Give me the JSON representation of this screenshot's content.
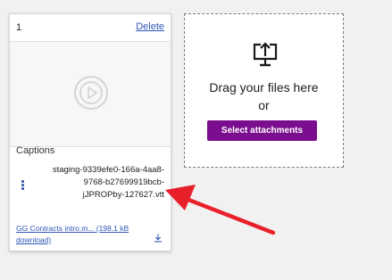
{
  "card": {
    "index": "1",
    "delete_label": "Delete",
    "captions_title": "Captions",
    "caption_file_lines": [
      "staging-9339efe0-166a-4aa8-",
      "9768-b27699919bcb-",
      "jJPROPby-127627.vtt"
    ],
    "download_lines": [
      "GG Contracts intro.m... (198.1 kB",
      "download)"
    ],
    "icons": {
      "video": "play-circle-icon",
      "menu": "more-vertical-icon",
      "download": "download-icon"
    }
  },
  "dropzone": {
    "title": "Drag your files here",
    "or_label": "or",
    "button_label": "Select attachments",
    "icon": "upload-icon"
  },
  "colors": {
    "accent": "#7b0e8e",
    "link": "#2f55b6",
    "annotation": "#e8202a"
  }
}
